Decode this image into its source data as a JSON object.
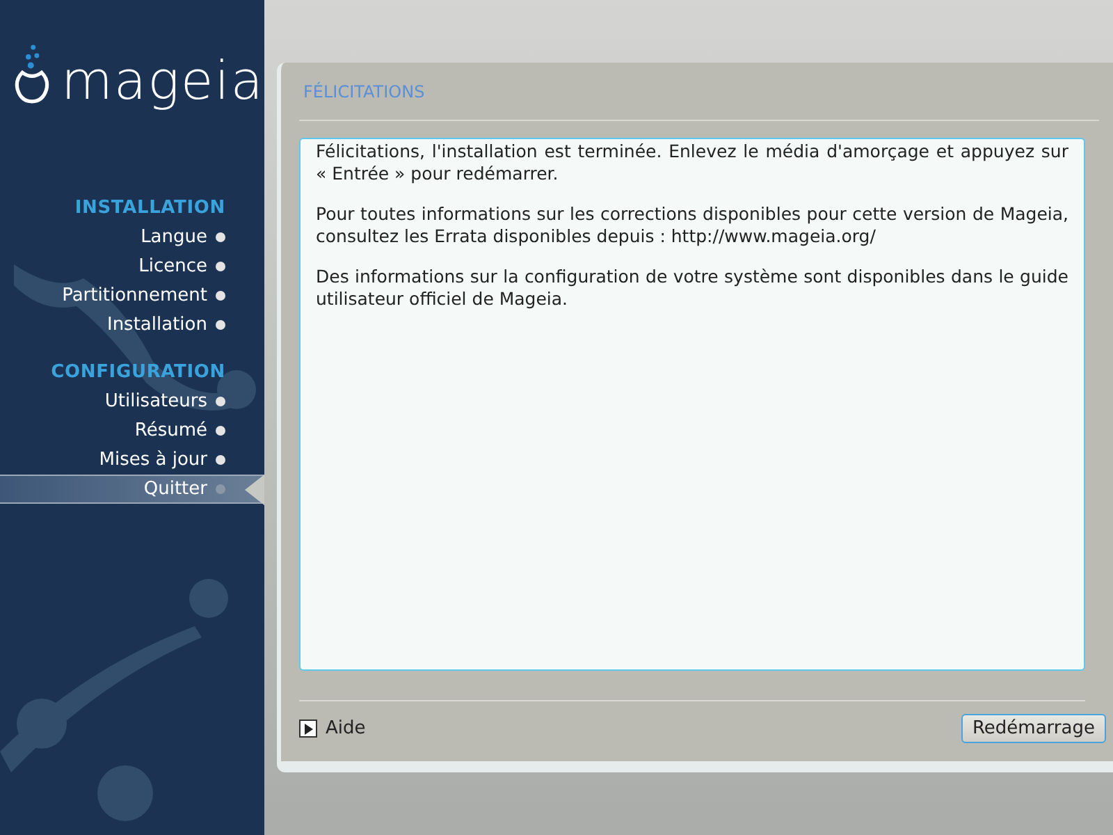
{
  "logo": {
    "text": "mageia"
  },
  "sidebar": {
    "sections": [
      {
        "title": "INSTALLATION",
        "items": [
          {
            "label": "Langue",
            "selected": false
          },
          {
            "label": "Licence",
            "selected": false
          },
          {
            "label": "Partitionnement",
            "selected": false
          },
          {
            "label": "Installation",
            "selected": false
          }
        ]
      },
      {
        "title": "CONFIGURATION",
        "items": [
          {
            "label": "Utilisateurs",
            "selected": false
          },
          {
            "label": "Résumé",
            "selected": false
          },
          {
            "label": "Mises à jour",
            "selected": false
          },
          {
            "label": "Quitter",
            "selected": true
          }
        ]
      }
    ]
  },
  "panel": {
    "title": "FÉLICITATIONS",
    "paragraphs": [
      "Félicitations, l'installation est terminée. Enlevez le média d'amorçage et appuyez sur « Entrée » pour redémarrer.",
      "Pour toutes informations sur les corrections disponibles pour cette version de Mageia, consultez les Errata disponibles depuis : http://www.mageia.org/",
      "Des informations sur la configuration de votre système sont disponibles dans le guide utilisateur officiel de Mageia."
    ],
    "help": {
      "label": "Aide",
      "expanded": false
    },
    "buttons": [
      "Redémarrage"
    ]
  }
}
